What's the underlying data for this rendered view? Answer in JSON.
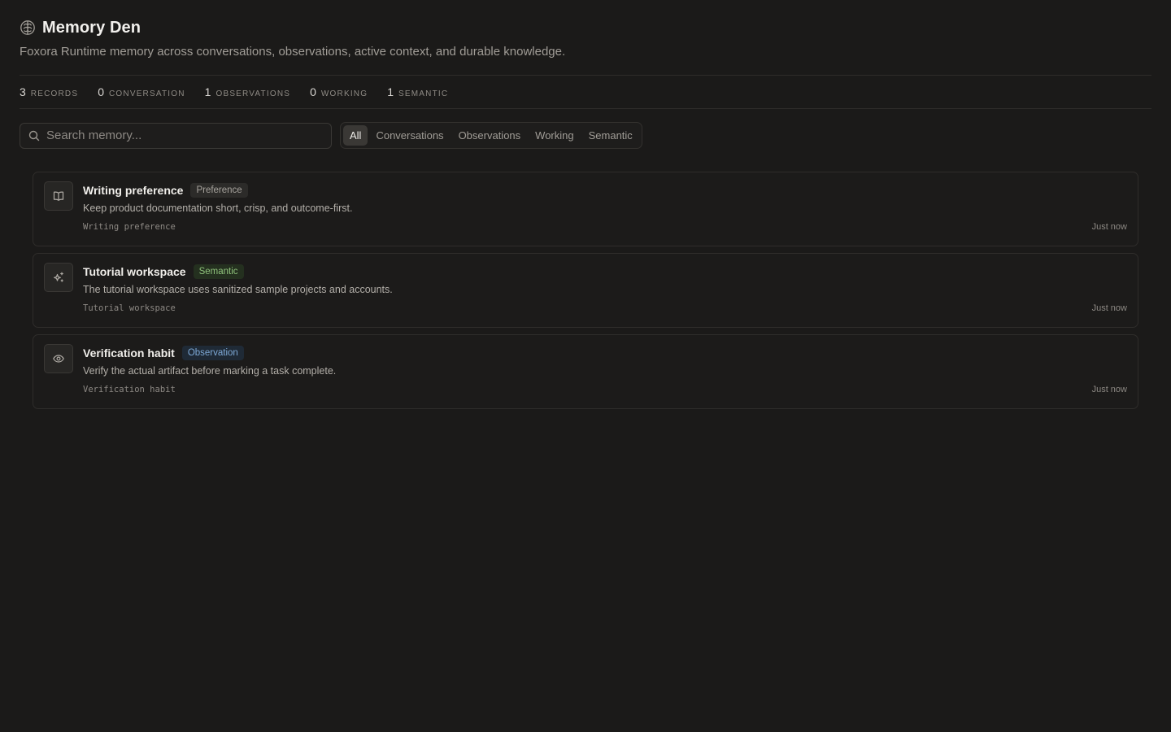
{
  "header": {
    "title": "Memory Den",
    "subtitle": "Foxora Runtime memory across conversations, observations, active context, and durable knowledge."
  },
  "stats": [
    {
      "value": "3",
      "label": "Records"
    },
    {
      "value": "0",
      "label": "Conversation"
    },
    {
      "value": "1",
      "label": "Observations"
    },
    {
      "value": "0",
      "label": "Working"
    },
    {
      "value": "1",
      "label": "Semantic"
    }
  ],
  "search": {
    "placeholder": "Search memory...",
    "value": ""
  },
  "tabs": [
    {
      "label": "All",
      "active": true
    },
    {
      "label": "Conversations",
      "active": false
    },
    {
      "label": "Observations",
      "active": false
    },
    {
      "label": "Working",
      "active": false
    },
    {
      "label": "Semantic",
      "active": false
    }
  ],
  "memories": [
    {
      "title": "Writing preference",
      "badge": "Preference",
      "icon": "book-icon",
      "text": "Keep product documentation short, crisp, and outcome-first.",
      "key": "Writing preference",
      "time": "Just now"
    },
    {
      "title": "Tutorial workspace",
      "badge": "Semantic",
      "icon": "sparkles-icon",
      "text": "The tutorial workspace uses sanitized sample projects and accounts.",
      "key": "Tutorial workspace",
      "time": "Just now"
    },
    {
      "title": "Verification habit",
      "badge": "Observation",
      "icon": "eye-icon",
      "text": "Verify the actual artifact before marking a task complete.",
      "key": "Verification habit",
      "time": "Just now"
    }
  ],
  "colors": {
    "background": "#1b1a19",
    "semantic_badge": "#8fc27b",
    "observation_badge": "#7ea9d6",
    "preference_badge": "#a7a39d"
  }
}
